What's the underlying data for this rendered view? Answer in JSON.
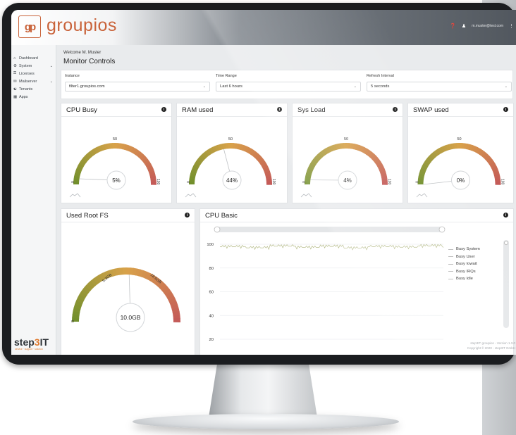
{
  "app": {
    "logo_mark": "gp",
    "name": "groupios"
  },
  "topbar": {
    "help_icon": "question-icon",
    "user_icon": "user-icon",
    "user_email": "m.muster@test.com",
    "menu_icon": "kebab-icon"
  },
  "sidebar": {
    "items": [
      {
        "label": "Dashboard",
        "icon": "home-icon",
        "expandable": false
      },
      {
        "label": "System",
        "icon": "gear-icon",
        "expandable": true
      },
      {
        "label": "Licenses",
        "icon": "key-icon",
        "expandable": false
      },
      {
        "label": "Mailserver",
        "icon": "mail-icon",
        "expandable": true
      },
      {
        "label": "Tenants",
        "icon": "users-icon",
        "expandable": false
      },
      {
        "label": "Apps",
        "icon": "apps-icon",
        "expandable": false
      }
    ],
    "brand_main": "step",
    "brand_accent": "3",
    "brand_end": "IT",
    "brand_tagline": "service · support · solution"
  },
  "main": {
    "welcome": "Welcome M. Muster",
    "title": "Monitor Controls",
    "filters": [
      {
        "label": "Instance",
        "value": "filter1.groupios.com"
      },
      {
        "label": "Time Range",
        "value": "Last 6 hours"
      },
      {
        "label": "Refresh Interval",
        "value": "5 seconds"
      }
    ]
  },
  "gauges": [
    {
      "title": "CPU Busy",
      "value": "5%",
      "fraction": 0.05,
      "min": "0",
      "mid": "50",
      "max": "100"
    },
    {
      "title": "RAM used",
      "value": "44%",
      "fraction": 0.44,
      "min": "0",
      "mid": "50",
      "max": "100"
    },
    {
      "title": "Sys Load",
      "value": "4%",
      "fraction": 0.04,
      "min": "0",
      "mid": "50",
      "max": "100"
    },
    {
      "title": "SWAP used",
      "value": "0%",
      "fraction": 0.0,
      "min": "0",
      "mid": "50",
      "max": "100"
    }
  ],
  "rootfs": {
    "title": "Used Root FS",
    "value": "10.0GB",
    "fraction": 0.52,
    "min": "0",
    "tick1": "9.3GB",
    "tick2": "18.6GB"
  },
  "cpu_basic": {
    "title": "CPU Basic",
    "legend": [
      "Busy System",
      "Busy User",
      "Busy Iowait",
      "Busy IRQs",
      "Busy Idle"
    ],
    "series_colors": [
      "#8c8f92",
      "#8c8f92",
      "#8c8f92",
      "#8c8f92",
      "#b6bc8a"
    ]
  },
  "chart_data": {
    "type": "line",
    "title": "CPU Basic",
    "y_ticks": [
      100,
      80,
      60,
      40,
      20
    ],
    "ylim": [
      20,
      100
    ],
    "series": [
      {
        "name": "Busy System",
        "values": []
      },
      {
        "name": "Busy User",
        "values": []
      },
      {
        "name": "Busy Iowait",
        "values": []
      },
      {
        "name": "Busy IRQs",
        "values": []
      },
      {
        "name": "Busy Idle",
        "values": [
          98.5,
          97.6,
          99.0,
          97.9,
          98.8,
          97.3,
          98.6,
          98.1,
          99.2,
          97.8
        ]
      }
    ],
    "legend_position": "right"
  },
  "footer": {
    "line1": "step3IT groupios - Version 1.3.0",
    "line2": "Copyright © 2020 - step3IT GmbH"
  },
  "colors": {
    "brand": "#c9633a",
    "gauge_low": "#6f8f2b",
    "gauge_mid": "#d8a24a",
    "gauge_high": "#c45a58"
  }
}
